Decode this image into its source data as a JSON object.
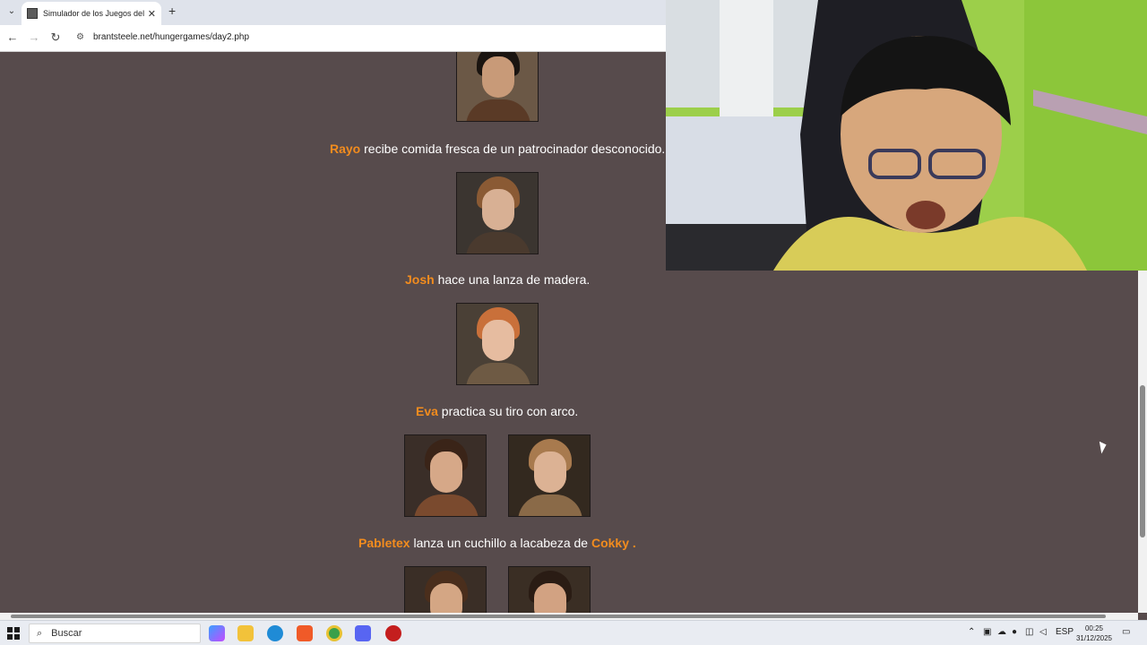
{
  "browser": {
    "tab_title": "Simulador de los Juegos del Ha",
    "url": "brantsteele.net/hungergames/day2.php"
  },
  "events": [
    {
      "name": "Rayo",
      "text": " recibe comida fresca de un patrocinador desconocido."
    },
    {
      "name": "Josh",
      "text": " hace una lanza de madera."
    },
    {
      "name": "Eva",
      "text": " practica su tiro con arco."
    },
    {
      "name": "Pabletex",
      "text": " lanza un cuchillo a lacabeza de ",
      "name2": "Cokky",
      "text2": " ."
    }
  ],
  "taskbar": {
    "search_placeholder": "Buscar",
    "language": "ESP",
    "time": "00:25",
    "date": "31/12/2025"
  },
  "icons": {
    "start": "windows-start-icon",
    "search": "search-icon",
    "tray_chevron": "chevron-up-icon"
  },
  "colors": {
    "page_bg": "#574b4c",
    "name_accent": "#f28c1e"
  }
}
